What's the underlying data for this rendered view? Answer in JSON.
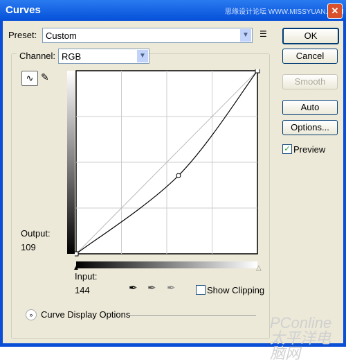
{
  "window": {
    "title": "Curves",
    "watermark": "思缘设计论坛 WWW.MISSYUAN.COM",
    "close_glyph": "✕"
  },
  "preset": {
    "label": "Preset:",
    "value": "Custom"
  },
  "channel": {
    "label": "Channel:",
    "value": "RGB"
  },
  "buttons": {
    "ok": "OK",
    "cancel": "Cancel",
    "smooth": "Smooth",
    "auto": "Auto",
    "options": "Options..."
  },
  "preview": {
    "label": "Preview",
    "checked": true
  },
  "output": {
    "label": "Output:",
    "value": "109"
  },
  "input": {
    "label": "Input:",
    "value": "144"
  },
  "show_clipping": {
    "label": "Show Clipping",
    "checked": false
  },
  "curve_display_options": "Curve Display Options",
  "footer_watermark": "PConline 太平洋电脑网",
  "chart_data": {
    "type": "line",
    "xlim": [
      0,
      255
    ],
    "ylim": [
      0,
      255
    ],
    "grid": "4x4",
    "points": [
      [
        0,
        0
      ],
      [
        144,
        109
      ],
      [
        255,
        255
      ]
    ],
    "selected_point": [
      144,
      109
    ]
  }
}
